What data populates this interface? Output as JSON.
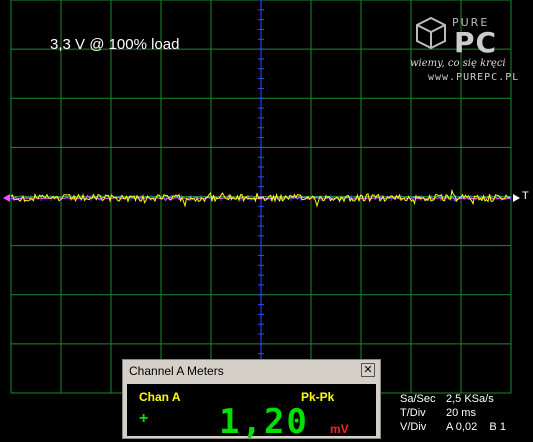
{
  "scope": {
    "overlay_label": "3,3 V @ 100% load",
    "trigger_marker": "T",
    "colors": {
      "grid": "#1c8a2e",
      "axis": "#2a4dff",
      "trace_a": "#ffff00",
      "trace_b": "#ff50ff",
      "background": "#000000"
    }
  },
  "logo": {
    "brand_top": "PURE",
    "brand_main": "PC",
    "tagline": "wiemy, co się kręci",
    "url": "www.PUREPC.PL"
  },
  "meters_window": {
    "title": "Channel A Meters",
    "close_label": "✕",
    "channel": "Chan A",
    "mode": "Pk-Pk",
    "sign": "+",
    "value": "1,20",
    "unit": "mV"
  },
  "readouts": {
    "sa_sec": {
      "key": "Sa/Sec",
      "value": "2,5 KSa/s"
    },
    "t_div": {
      "key": "T/Div",
      "value": "20 ms"
    },
    "v_div": {
      "key": "V/Div",
      "value": "A 0,02    B 1"
    }
  }
}
